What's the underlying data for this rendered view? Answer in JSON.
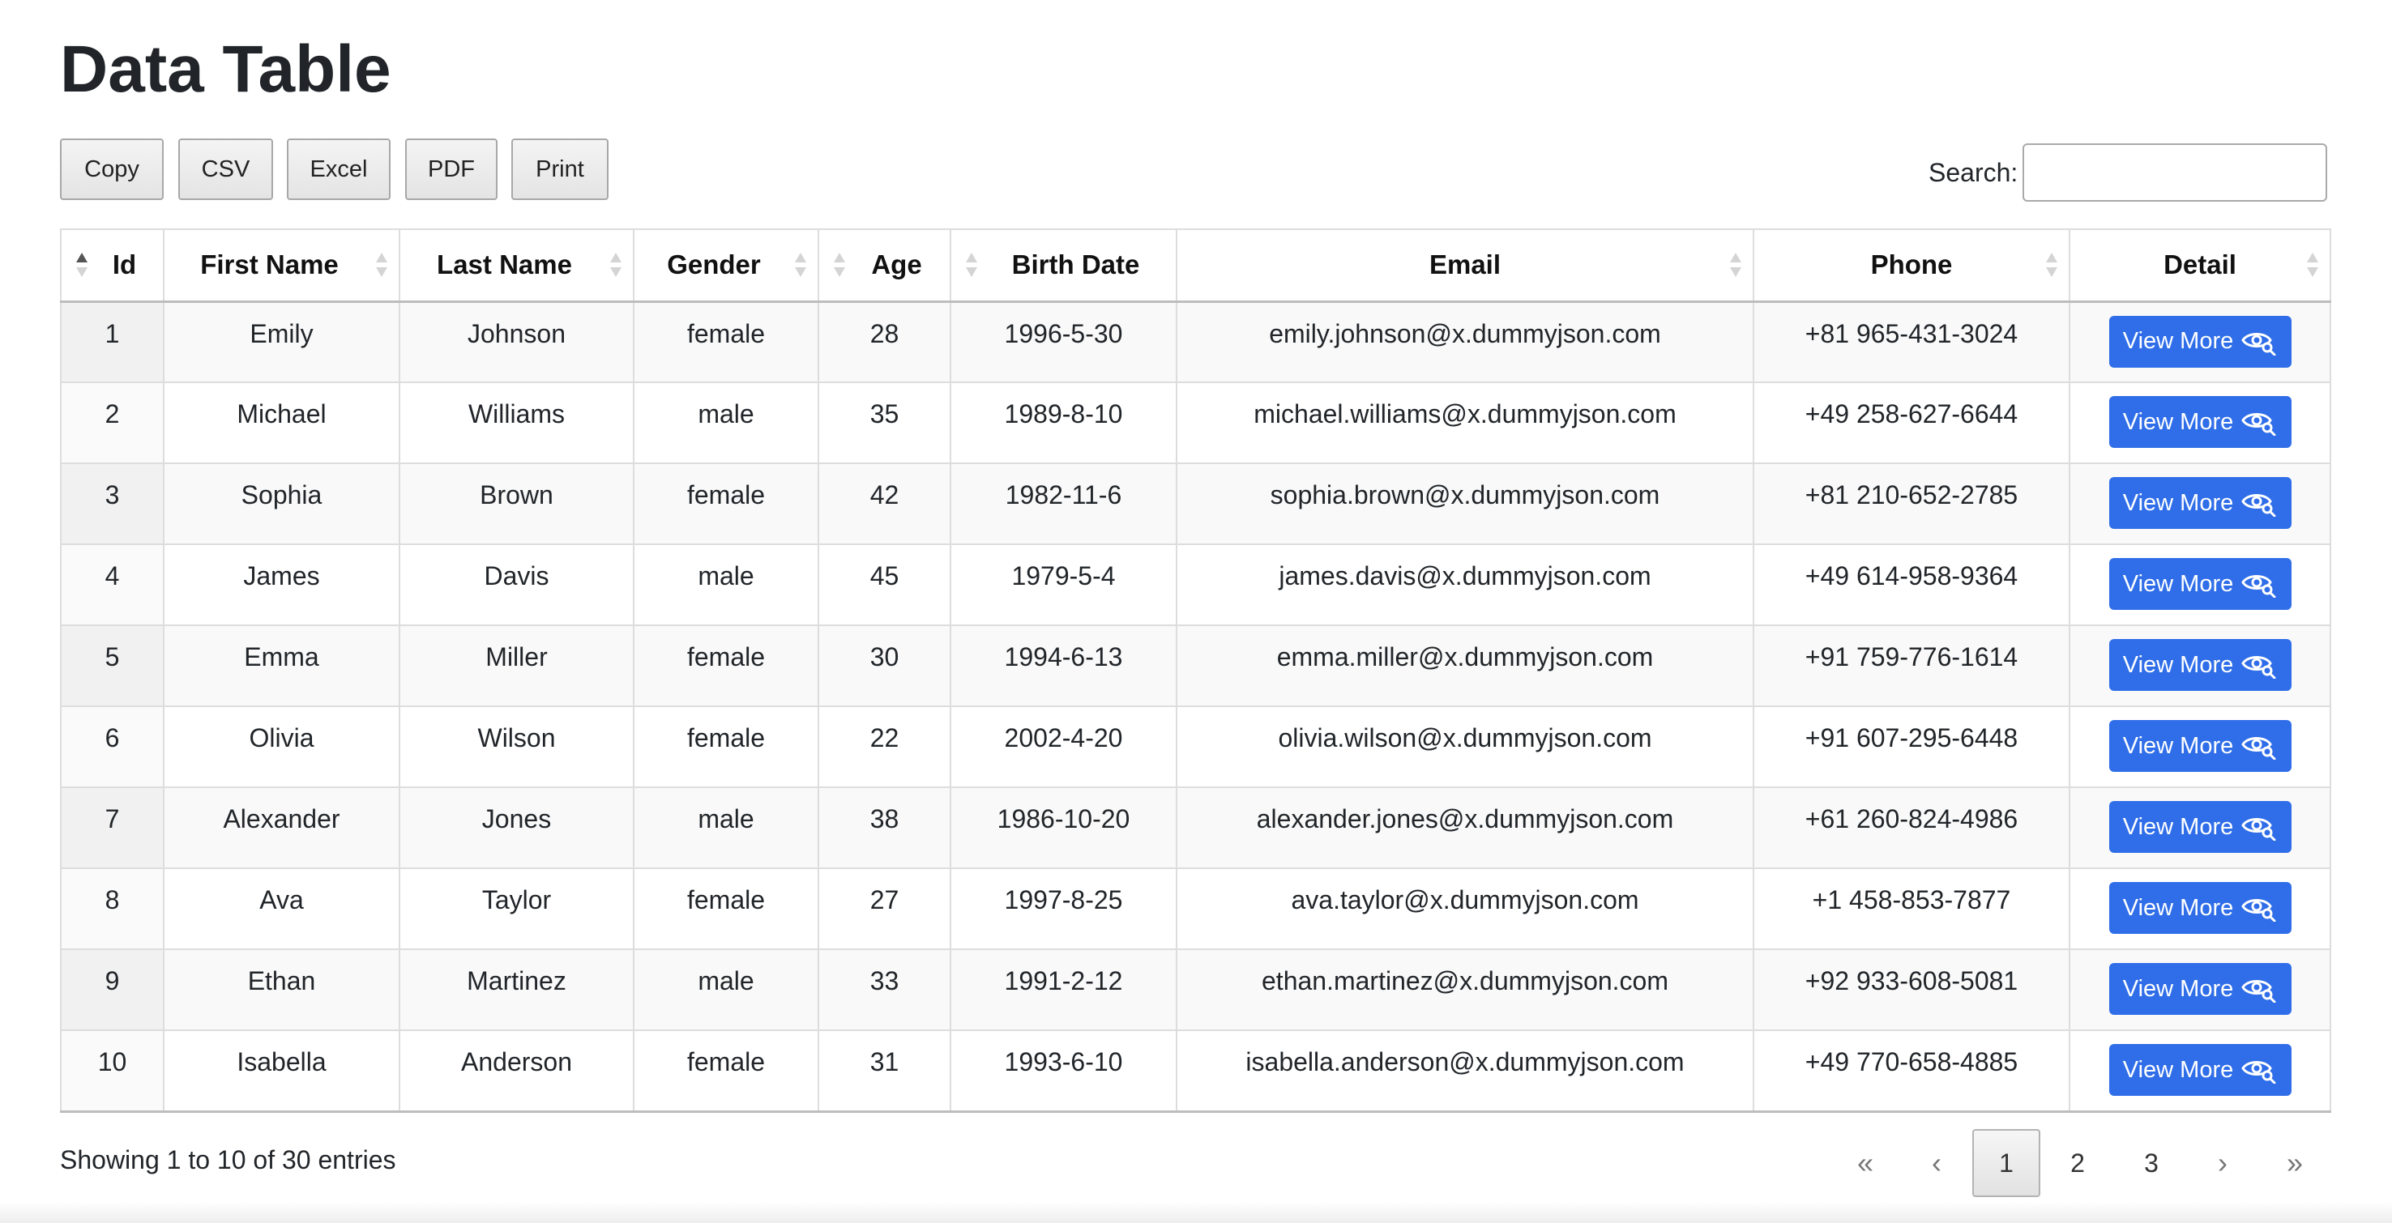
{
  "page": {
    "title": "Data Table"
  },
  "toolbar": {
    "buttons": [
      "Copy",
      "CSV",
      "Excel",
      "PDF",
      "Print"
    ],
    "search_label": "Search:",
    "search_value": ""
  },
  "table": {
    "columns": [
      "Id",
      "First Name",
      "Last Name",
      "Gender",
      "Age",
      "Birth Date",
      "Email",
      "Phone",
      "Detail"
    ],
    "sorted_column": "Id",
    "sort_direction": "ascending",
    "rows": [
      {
        "id": "1",
        "first_name": "Emily",
        "last_name": "Johnson",
        "gender": "female",
        "age": "28",
        "birth_date": "1996-5-30",
        "email": "emily.johnson@x.dummyjson.com",
        "phone": "+81 965-431-3024",
        "detail": "View More"
      },
      {
        "id": "2",
        "first_name": "Michael",
        "last_name": "Williams",
        "gender": "male",
        "age": "35",
        "birth_date": "1989-8-10",
        "email": "michael.williams@x.dummyjson.com",
        "phone": "+49 258-627-6644",
        "detail": "View More"
      },
      {
        "id": "3",
        "first_name": "Sophia",
        "last_name": "Brown",
        "gender": "female",
        "age": "42",
        "birth_date": "1982-11-6",
        "email": "sophia.brown@x.dummyjson.com",
        "phone": "+81 210-652-2785",
        "detail": "View More"
      },
      {
        "id": "4",
        "first_name": "James",
        "last_name": "Davis",
        "gender": "male",
        "age": "45",
        "birth_date": "1979-5-4",
        "email": "james.davis@x.dummyjson.com",
        "phone": "+49 614-958-9364",
        "detail": "View More"
      },
      {
        "id": "5",
        "first_name": "Emma",
        "last_name": "Miller",
        "gender": "female",
        "age": "30",
        "birth_date": "1994-6-13",
        "email": "emma.miller@x.dummyjson.com",
        "phone": "+91 759-776-1614",
        "detail": "View More"
      },
      {
        "id": "6",
        "first_name": "Olivia",
        "last_name": "Wilson",
        "gender": "female",
        "age": "22",
        "birth_date": "2002-4-20",
        "email": "olivia.wilson@x.dummyjson.com",
        "phone": "+91 607-295-6448",
        "detail": "View More"
      },
      {
        "id": "7",
        "first_name": "Alexander",
        "last_name": "Jones",
        "gender": "male",
        "age": "38",
        "birth_date": "1986-10-20",
        "email": "alexander.jones@x.dummyjson.com",
        "phone": "+61 260-824-4986",
        "detail": "View More"
      },
      {
        "id": "8",
        "first_name": "Ava",
        "last_name": "Taylor",
        "gender": "female",
        "age": "27",
        "birth_date": "1997-8-25",
        "email": "ava.taylor@x.dummyjson.com",
        "phone": "+1 458-853-7877",
        "detail": "View More"
      },
      {
        "id": "9",
        "first_name": "Ethan",
        "last_name": "Martinez",
        "gender": "male",
        "age": "33",
        "birth_date": "1991-2-12",
        "email": "ethan.martinez@x.dummyjson.com",
        "phone": "+92 933-608-5081",
        "detail": "View More"
      },
      {
        "id": "10",
        "first_name": "Isabella",
        "last_name": "Anderson",
        "gender": "female",
        "age": "31",
        "birth_date": "1993-6-10",
        "email": "isabella.anderson@x.dummyjson.com",
        "phone": "+49 770-658-4885",
        "detail": "View More"
      }
    ]
  },
  "footer": {
    "info": "Showing 1 to 10 of 30 entries",
    "pagination": {
      "first": "«",
      "previous": "‹",
      "pages": [
        "1",
        "2",
        "3"
      ],
      "current_page": "1",
      "next": "›",
      "last": "»"
    }
  },
  "colors": {
    "accent": "#2f6ee8",
    "text": "#212529",
    "border": "#dddddd",
    "stripe": "#f9f9f9"
  },
  "icons": {
    "view_more": "eye-search-icon",
    "sort": "sort-arrows-icon"
  }
}
